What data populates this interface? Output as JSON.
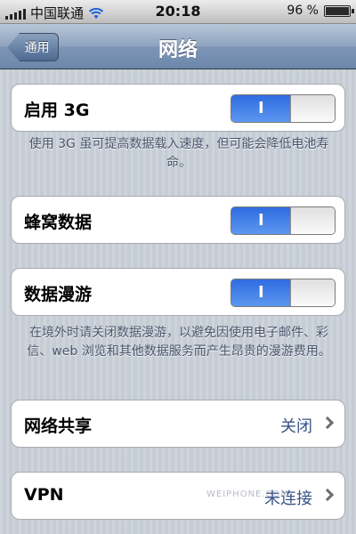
{
  "status_bar": {
    "carrier": "中国联通",
    "time": "20:18",
    "battery": "96 %",
    "battery_level": 96
  },
  "nav": {
    "back_label": "通用",
    "title": "网络"
  },
  "settings": {
    "enable_3g": {
      "label": "启用 3G",
      "state": "I",
      "on": true
    },
    "enable_3g_footer": "使用 3G 虽可提高数据载入速度，但可能会降低电池寿命。",
    "cellular_data": {
      "label": "蜂窝数据",
      "state": "I",
      "on": true
    },
    "data_roaming": {
      "label": "数据漫游",
      "state": "I",
      "on": true
    },
    "data_roaming_footer": "在境外时请关闭数据漫游，以避免因使用电子邮件、彩信、web 浏览和其他数据服务而产生昂贵的漫游费用。",
    "tethering": {
      "label": "网络共享",
      "value": "关闭"
    },
    "vpn": {
      "label": "VPN",
      "value": "未连接"
    }
  },
  "watermark": "WEIPHONE.COM",
  "colors": {
    "toggle_on": "#2f6ce0",
    "value_text": "#385487",
    "background": "#c5ccd4"
  },
  "icons": [
    "signal-bars-icon",
    "wifi-icon",
    "battery-icon",
    "chevron-right-icon",
    "back-arrow-icon"
  ]
}
